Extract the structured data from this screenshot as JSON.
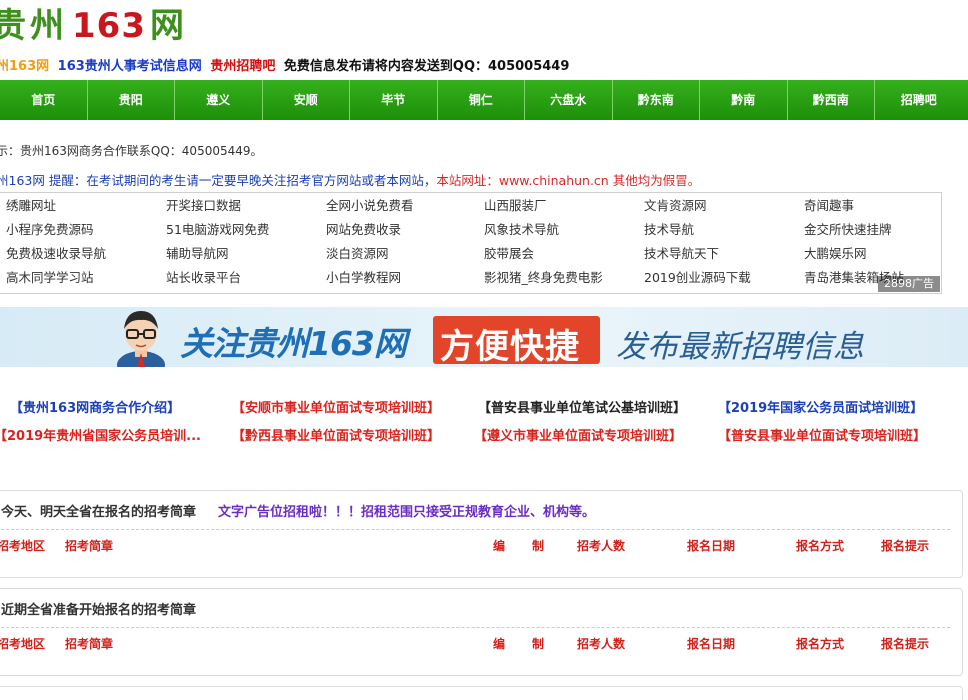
{
  "logo": {
    "cn_left": "贵州",
    "num": "163",
    "cn_right": "网"
  },
  "toplinks": {
    "a": "州163网",
    "b": "163贵州人事考试信息网",
    "c": "贵州招聘吧",
    "d": "免费信息发布请将内容发送到QQ：405005449"
  },
  "nav": [
    "首页",
    "贵阳",
    "遵义",
    "安顺",
    "毕节",
    "铜仁",
    "六盘水",
    "黔东南",
    "黔南",
    "黔西南",
    "招聘吧"
  ],
  "notices": {
    "line1": "示：贵州163网商务合作联系QQ：405005449。",
    "line2_blue": "州163网 提醒：在考试期间的考生请一定要早晚关注招考官方网站或者本网站，",
    "line2_red": "本站网址：www.chinahun.cn  其他均为假冒。"
  },
  "links": [
    "绣雕网址",
    "开奖接口数据",
    "全网小说免费看",
    "山西服装厂",
    "文肯资源网",
    "奇闻趣事",
    "小程序免费源码",
    "51电脑游戏网免费",
    "网站免费收录",
    "风象技术导航",
    "技术导航",
    "金交所快速挂牌",
    "免费极速收录导航",
    "辅助导航网",
    "淡白资源网",
    "胶带展会",
    "技术导航天下",
    "大鹏娱乐网",
    "高木同学学习站",
    "站长收录平台",
    "小白学教程网",
    "影视猪_终身免费电影",
    "2019创业源码下载",
    "青岛港集装箱场站"
  ],
  "ad_tag": "2898广告",
  "banner": {
    "text1": "关注贵州163网",
    "text2": "方便快捷",
    "text3": "发布最新招聘信息"
  },
  "promos_row1": [
    {
      "text": "【贵州163网商务合作介绍】",
      "color": "blue"
    },
    {
      "text": "【安顺市事业单位面试专项培训班】",
      "color": "red"
    },
    {
      "text": "【普安县事业单位笔试公基培训班】",
      "color": "black"
    },
    {
      "text": "【2019年国家公务员面试培训班】",
      "color": "blue"
    }
  ],
  "promos_row2": [
    {
      "text": "【2019年贵州省国家公务员培训...",
      "color": "red"
    },
    {
      "text": "【黔西县事业单位面试专项培训班】",
      "color": "red"
    },
    {
      "text": "【遵义市事业单位面试专项培训班】",
      "color": "red"
    },
    {
      "text": "【普安县事业单位面试专项培训班】",
      "color": "red"
    }
  ],
  "panel1": {
    "title": "今天、明天全省在报名的招考简章",
    "adv": "文字广告位招租啦！！！招租范围只接受正规教育企业、机构等。"
  },
  "panel2": {
    "title": "近期全省准备开始报名的招考简章"
  },
  "columns": [
    "招考地区",
    "招考简章",
    "编",
    "制",
    "招考人数",
    "报名日期",
    "报名方式",
    "报名提示"
  ]
}
